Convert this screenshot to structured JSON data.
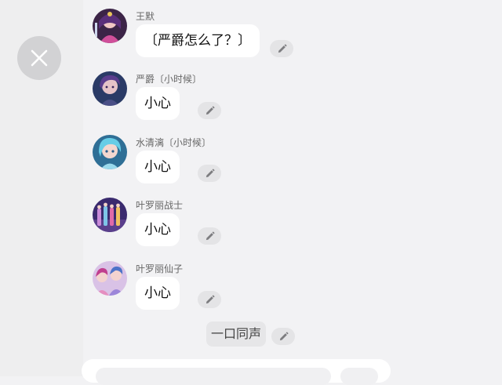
{
  "close_button": {
    "icon": "close-icon"
  },
  "messages": [
    {
      "sender": "王默",
      "text": "〔严爵怎么了？〕",
      "avatar": "avatar-wangmo"
    },
    {
      "sender": "严爵〔小时候〕",
      "text": "小心",
      "avatar": "avatar-yanjue"
    },
    {
      "sender": "水清漓〔小时候〕",
      "text": "小心",
      "avatar": "avatar-shuiqingli"
    },
    {
      "sender": "叶罗丽战士",
      "text": "小心",
      "avatar": "avatar-yeluoli-warriors"
    },
    {
      "sender": "叶罗丽仙子",
      "text": "小心",
      "avatar": "avatar-yeluoli-fairies"
    }
  ],
  "chorus": {
    "text": "一口同声"
  },
  "edit_icon": "pencil-icon",
  "colors": {
    "background": "#f2f2f4",
    "bubble": "#ffffff",
    "edit_button": "#e4e4e6",
    "close_button": "#d2d2d4"
  }
}
